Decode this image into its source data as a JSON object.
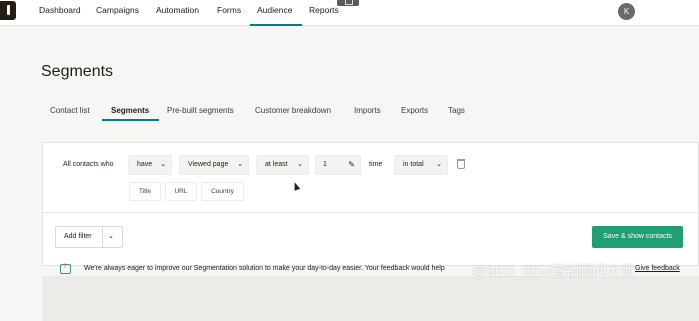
{
  "nav": {
    "items": [
      {
        "label": "Dashboard"
      },
      {
        "label": "Campaigns"
      },
      {
        "label": "Automation"
      },
      {
        "label": "Forms"
      },
      {
        "label": "Audience"
      },
      {
        "label": "Reports"
      }
    ],
    "active": "Audience",
    "avatar_initial": "K"
  },
  "page": {
    "title": "Segments"
  },
  "tabs": [
    {
      "label": "Contact list"
    },
    {
      "label": "Segments"
    },
    {
      "label": "Pre-built segments"
    },
    {
      "label": "Customer breakdown"
    },
    {
      "label": "Imports"
    },
    {
      "label": "Exports"
    },
    {
      "label": "Tags"
    }
  ],
  "active_tab": "Segments",
  "filter": {
    "prefix_label": "All contacts who",
    "condition_select": "have",
    "action_select": "Viewed page",
    "comparator_select": "at least",
    "count_value": "1",
    "unit_label": "time",
    "period_select": "in total",
    "chips": [
      "Title",
      "URL",
      "Country"
    ]
  },
  "actions": {
    "add_filter": "Add filter",
    "save_show": "Save & show contacts"
  },
  "feedback": {
    "text": "We're always eager to improve our Segmentation solution to make your day-to-day easier. Your feedback would help",
    "link": "Give feedback",
    "watermark": "@SEO_SEM营销顾问大师"
  },
  "colors": {
    "accent": "#007c89",
    "primary_button": "#1f9f72",
    "background": "#f6f6f4"
  },
  "icons": {
    "chevron": "chevron-down-icon",
    "pencil": "pencil-icon",
    "trash": "trash-icon",
    "feedback": "feedback-icon"
  }
}
